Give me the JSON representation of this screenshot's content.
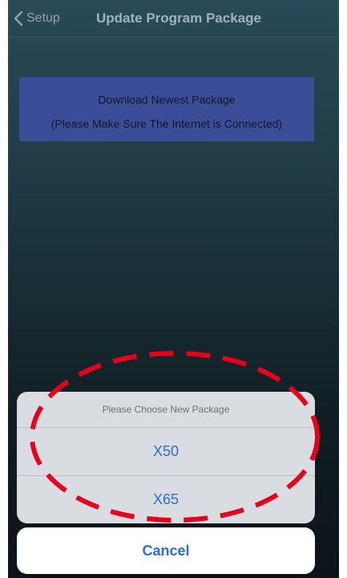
{
  "navbar": {
    "back_label": "Setup",
    "back_icon": "chevron-left-icon",
    "title": "Update Program Package"
  },
  "download": {
    "line1": "Download Newest Package",
    "line2": "(Please Make Sure The Internet is Connected)"
  },
  "action_sheet": {
    "title": "Please Choose New Package",
    "options": [
      {
        "label": "X50"
      },
      {
        "label": "X65"
      }
    ],
    "cancel_label": "Cancel"
  },
  "colors": {
    "accent": "#2b6fd6",
    "download_button": "#3c4d98",
    "highlight_annotation": "#e8001a"
  }
}
